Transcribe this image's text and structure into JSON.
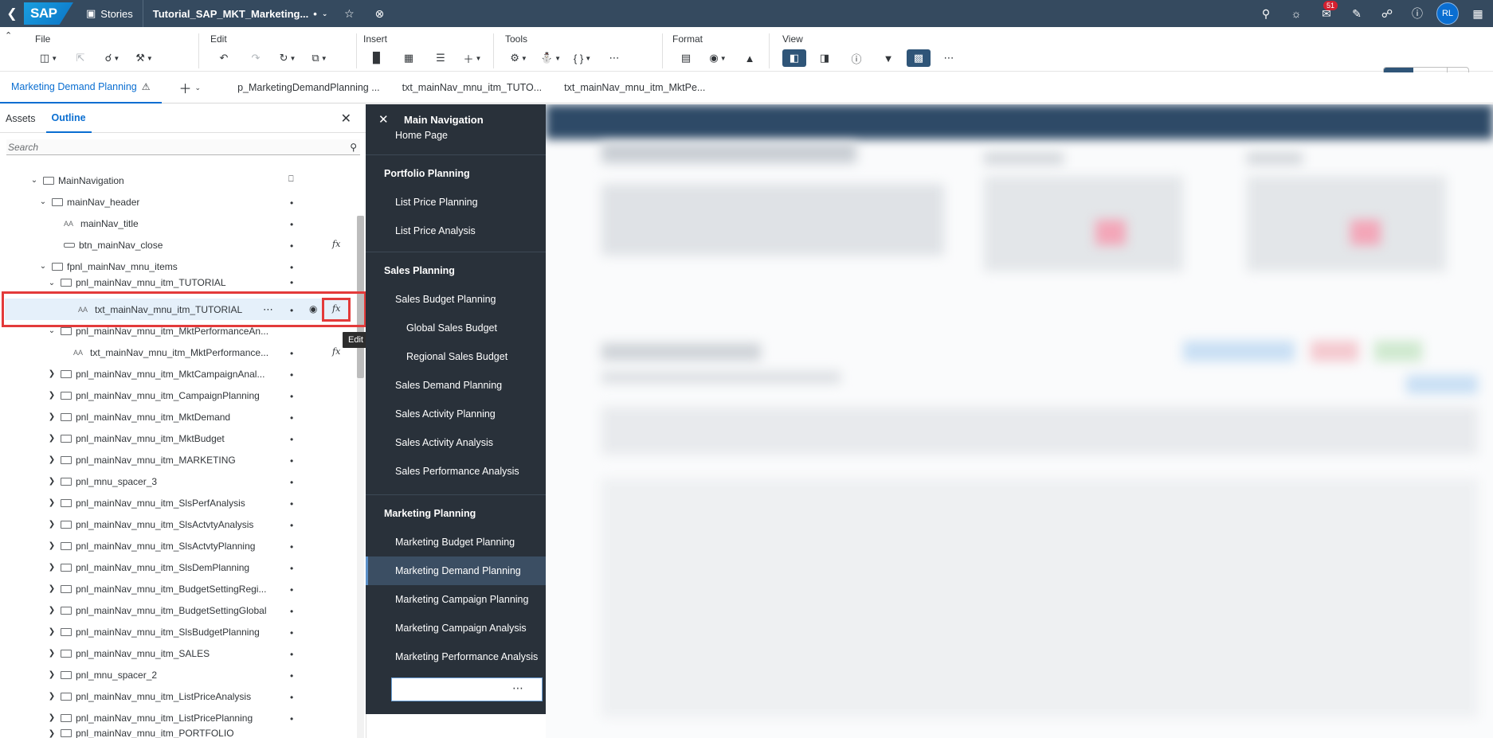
{
  "shell": {
    "logo": "SAP",
    "app_name": "Stories",
    "document_title": "Tutorial_SAP_MKT_Marketing...",
    "modified_marker": "•",
    "notification_count": "51",
    "user_initials": "RL"
  },
  "toolbar": {
    "groups": {
      "file": "File",
      "edit": "Edit",
      "insert": "Insert",
      "tools": "Tools",
      "format": "Format",
      "view": "View"
    },
    "edit_mode_label": "Edit",
    "view_mode_label": "View"
  },
  "tabs": [
    {
      "label": "Marketing Demand Planning"
    },
    {
      "label": "p_MarketingDemandPlanning ..."
    },
    {
      "label": "txt_mainNav_mnu_itm_TUTO..."
    },
    {
      "label": "txt_mainNav_mnu_itm_MktPe..."
    }
  ],
  "left_panel": {
    "tab_assets": "Assets",
    "tab_outline": "Outline",
    "search_placeholder": "Search",
    "tree": [
      {
        "label": "MainNavigation"
      },
      {
        "label": "mainNav_header"
      },
      {
        "label": "mainNav_title"
      },
      {
        "label": "btn_mainNav_close"
      },
      {
        "label": "fpnl_mainNav_mnu_items"
      },
      {
        "label": "pnl_mainNav_mnu_itm_TUTORIAL"
      },
      {
        "label": "txt_mainNav_mnu_itm_TUTORIAL"
      },
      {
        "label": "pnl_mainNav_mnu_itm_MktPerformanceAn..."
      },
      {
        "label": "txt_mainNav_mnu_itm_MktPerformance..."
      },
      {
        "label": "pnl_mainNav_mnu_itm_MktCampaignAnal..."
      },
      {
        "label": "pnl_mainNav_mnu_itm_CampaignPlanning"
      },
      {
        "label": "pnl_mainNav_mnu_itm_MktDemand"
      },
      {
        "label": "pnl_mainNav_mnu_itm_MktBudget"
      },
      {
        "label": "pnl_mainNav_mnu_itm_MARKETING"
      },
      {
        "label": "pnl_mnu_spacer_3"
      },
      {
        "label": "pnl_mainNav_mnu_itm_SlsPerfAnalysis"
      },
      {
        "label": "pnl_mainNav_mnu_itm_SlsActvtyAnalysis"
      },
      {
        "label": "pnl_mainNav_mnu_itm_SlsActvtyPlanning"
      },
      {
        "label": "pnl_mainNav_mnu_itm_SlsDemPlanning"
      },
      {
        "label": "pnl_mainNav_mnu_itm_BudgetSettingRegi..."
      },
      {
        "label": "pnl_mainNav_mnu_itm_BudgetSettingGlobal"
      },
      {
        "label": "pnl_mainNav_mnu_itm_SlsBudgetPlanning"
      },
      {
        "label": "pnl_mainNav_mnu_itm_SALES"
      },
      {
        "label": "pnl_mnu_spacer_2"
      },
      {
        "label": "pnl_mainNav_mnu_itm_ListPriceAnalysis"
      },
      {
        "label": "pnl_mainNav_mnu_itm_ListPricePlanning"
      },
      {
        "label": "pnl_mainNav_mnu_itm_PORTFOLIO"
      }
    ],
    "tooltip": "Edit Scripts"
  },
  "navigation": {
    "title": "Main Navigation",
    "items": [
      {
        "label": "Home Page"
      },
      {
        "label": "Portfolio Planning"
      },
      {
        "label": "List Price Planning"
      },
      {
        "label": "List Price Analysis"
      },
      {
        "label": "Sales Planning"
      },
      {
        "label": "Sales Budget Planning"
      },
      {
        "label": "Global Sales Budget"
      },
      {
        "label": "Regional Sales Budget"
      },
      {
        "label": "Sales Demand Planning"
      },
      {
        "label": "Sales Activity Planning"
      },
      {
        "label": "Sales Activity Analysis"
      },
      {
        "label": "Sales Performance Analysis"
      },
      {
        "label": "Marketing Planning"
      },
      {
        "label": "Marketing Budget Planning"
      },
      {
        "label": "Marketing Demand Planning"
      },
      {
        "label": "Marketing Campaign Planning"
      },
      {
        "label": "Marketing Campaign Analysis"
      },
      {
        "label": "Marketing Performance Analysis"
      }
    ]
  }
}
